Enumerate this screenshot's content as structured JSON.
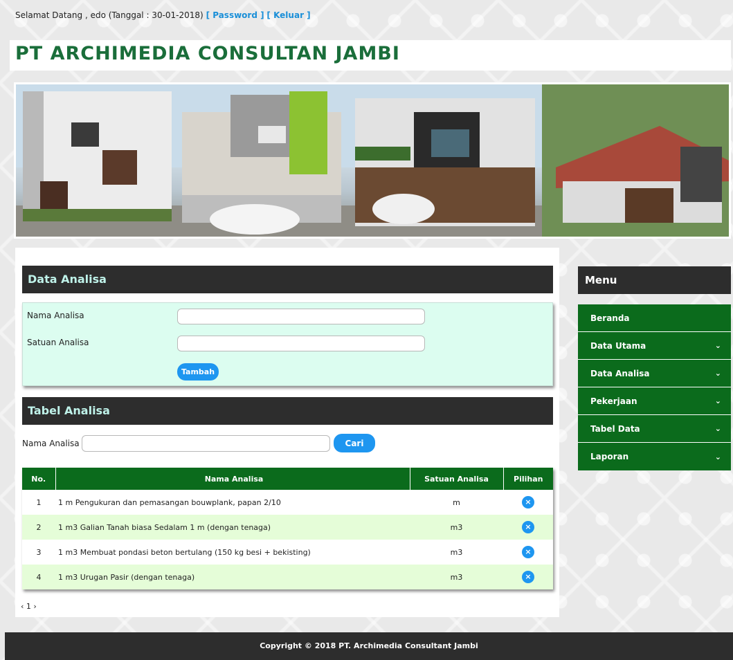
{
  "topbar": {
    "greeting": "Selamat Datang , edo (Tanggal : 30-01-2018)",
    "password_link": "[ Password ]",
    "logout_link": "[ Keluar ]"
  },
  "site": {
    "title": "PT ARCHIMEDIA CONSULTAN JAMBI"
  },
  "form_section": {
    "title": "Data Analisa",
    "fields": [
      {
        "label": "Nama Analisa",
        "value": ""
      },
      {
        "label": "Satuan Analisa",
        "value": ""
      }
    ],
    "submit_label": "Tambah"
  },
  "table_section": {
    "title": "Tabel Analisa",
    "search_label": "Nama Analisa :",
    "search_value": "",
    "search_button": "Cari",
    "columns": [
      "No.",
      "Nama Analisa",
      "Satuan Analisa",
      "Pilihan"
    ],
    "rows": [
      {
        "no": "1",
        "name": "1 m Pengukuran dan pemasangan bouwplank, papan 2/10",
        "unit": "m"
      },
      {
        "no": "2",
        "name": "1 m3 Galian Tanah biasa Sedalam 1 m (dengan tenaga)",
        "unit": "m3"
      },
      {
        "no": "3",
        "name": "1 m3 Membuat pondasi beton bertulang (150 kg besi + bekisting)",
        "unit": "m3"
      },
      {
        "no": "4",
        "name": "1 m3 Urugan Pasir (dengan tenaga)",
        "unit": "m3"
      }
    ],
    "delete_icon_glyph": "×",
    "pager": "‹ 1 ›"
  },
  "menu": {
    "title": "Menu",
    "items": [
      {
        "label": "Beranda",
        "has_submenu": false
      },
      {
        "label": "Data Utama",
        "has_submenu": true
      },
      {
        "label": "Data Analisa",
        "has_submenu": true
      },
      {
        "label": "Pekerjaan",
        "has_submenu": true
      },
      {
        "label": "Tabel Data",
        "has_submenu": true
      },
      {
        "label": "Laporan",
        "has_submenu": true
      }
    ],
    "chevron_glyph": "⌄"
  },
  "footer": {
    "text": "Copyright © 2018 PT. Archimedia Consultant Jambi"
  },
  "colors": {
    "header_dark": "#2d2d2d",
    "menu_green": "#0b6b1c",
    "title_green": "#1a6e3a",
    "accent_blue": "#1e96f0",
    "form_bg": "#dcfdf0",
    "row_alt": "#e5fdd8"
  }
}
